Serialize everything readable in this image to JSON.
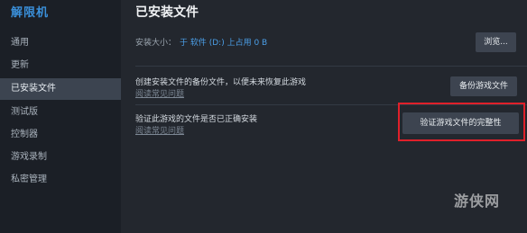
{
  "sidebar": {
    "app_title": "解限机",
    "items": [
      {
        "label": "通用"
      },
      {
        "label": "更新"
      },
      {
        "label": "已安装文件"
      },
      {
        "label": "测试版"
      },
      {
        "label": "控制器"
      },
      {
        "label": "游戏录制"
      },
      {
        "label": "私密管理"
      }
    ]
  },
  "main": {
    "title": "已安装文件",
    "install_size_label": "安装大小：",
    "install_size_value": "于 软件 (D:) 上占用 0 B",
    "browse_button": "浏览...",
    "backup": {
      "description": "创建安装文件的备份文件，以便未来恢复此游戏",
      "link": "阅读常见问题",
      "button": "备份游戏文件"
    },
    "verify": {
      "description": "验证此游戏的文件是否已正确安装",
      "link": "阅读常见问题",
      "button": "验证游戏文件的完整性"
    }
  },
  "watermark": "游侠网",
  "colors": {
    "accent": "#3a8fd9",
    "highlight": "#e0202a",
    "active_nav": "#3c4450"
  }
}
